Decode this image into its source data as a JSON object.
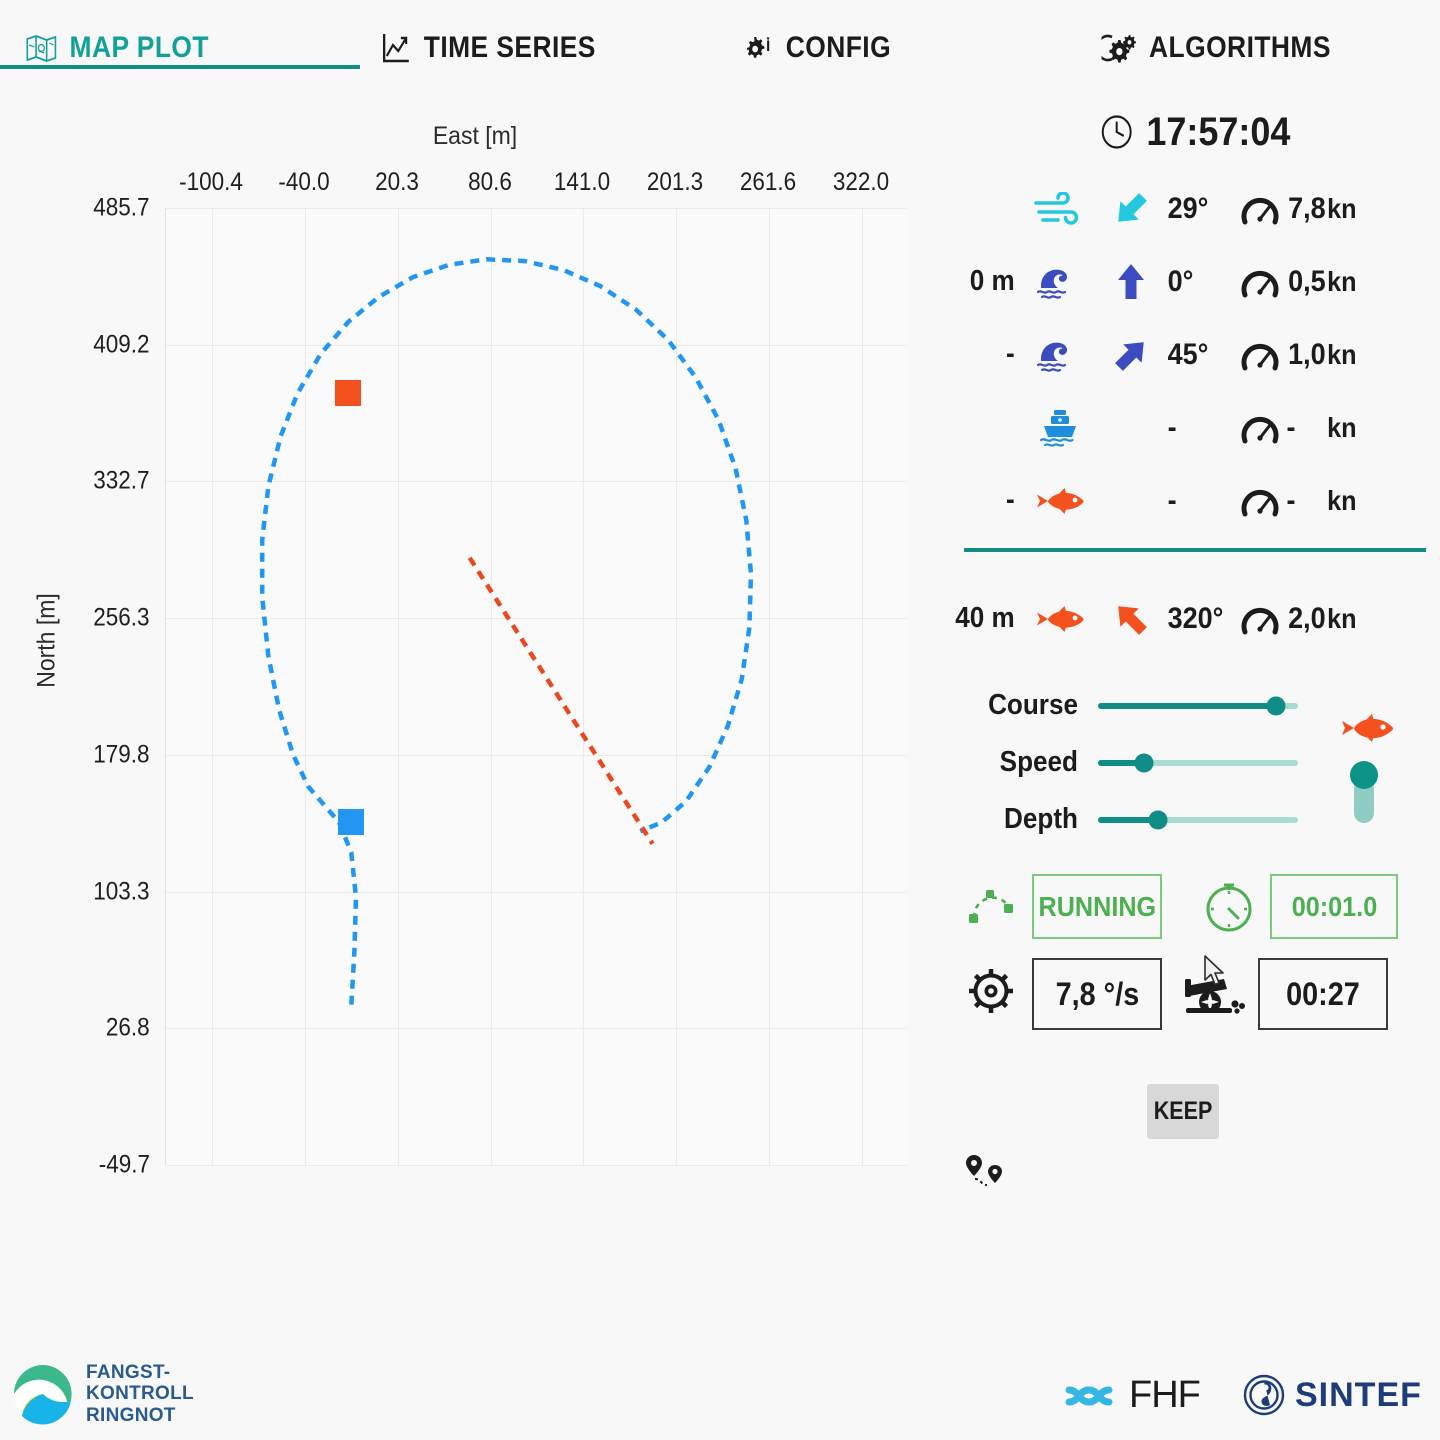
{
  "tabs": [
    {
      "label": "MAP PLOT",
      "icon": "map-icon",
      "active": true
    },
    {
      "label": "TIME SERIES",
      "icon": "line-chart-icon",
      "active": false
    },
    {
      "label": "CONFIG",
      "icon": "gear-wrench-icon",
      "active": false
    },
    {
      "label": "ALGORITHMS",
      "icon": "gears-icon",
      "active": false
    }
  ],
  "chart_data": {
    "type": "line",
    "title": "",
    "xlabel": "East [m]",
    "ylabel": "North [m]",
    "xlim": [
      -130.6,
      352.2
    ],
    "ylim": [
      -49.7,
      485.7
    ],
    "xticks": [
      "-100.4",
      "-40.0",
      "20.3",
      "80.6",
      "141.0",
      "201.3",
      "261.6",
      "322.0"
    ],
    "xtick_values": [
      -100.4,
      -40.0,
      20.3,
      80.6,
      141.0,
      201.3,
      261.6,
      322.0
    ],
    "yticks": [
      "485.7",
      "409.2",
      "332.7",
      "256.3",
      "179.8",
      "103.3",
      "26.8",
      "-49.7"
    ],
    "ytick_values": [
      485.7,
      409.2,
      332.7,
      256.3,
      179.8,
      103.3,
      26.8,
      -49.7
    ],
    "grid": true,
    "legend": "none",
    "series": [
      {
        "name": "vessel-track",
        "color": "#2196f3",
        "style": "dashed",
        "points": [
          [
            -10,
            40
          ],
          [
            -8,
            70
          ],
          [
            -7,
            100
          ],
          [
            -10,
            125
          ],
          [
            -18,
            142
          ],
          [
            -28,
            152
          ],
          [
            -38,
            162
          ],
          [
            -48,
            180
          ],
          [
            -57,
            205
          ],
          [
            -64,
            235
          ],
          [
            -68,
            268
          ],
          [
            -68,
            300
          ],
          [
            -64,
            330
          ],
          [
            -56,
            358
          ],
          [
            -45,
            382
          ],
          [
            -30,
            404
          ],
          [
            -12,
            422
          ],
          [
            8,
            436
          ],
          [
            30,
            447
          ],
          [
            54,
            454
          ],
          [
            78,
            457
          ],
          [
            103,
            456
          ],
          [
            128,
            451
          ],
          [
            152,
            442
          ],
          [
            175,
            429
          ],
          [
            196,
            412
          ],
          [
            214,
            391
          ],
          [
            229,
            367
          ],
          [
            240,
            340
          ],
          [
            247,
            311
          ],
          [
            250,
            281
          ],
          [
            249,
            251
          ],
          [
            244,
            222
          ],
          [
            235,
            196
          ],
          [
            223,
            173
          ],
          [
            208,
            154
          ],
          [
            192,
            142
          ],
          [
            178,
            137
          ]
        ]
      },
      {
        "name": "target-track",
        "color": "#e8491e",
        "style": "dashed",
        "points": [
          [
            67,
            290
          ],
          [
            186,
            130
          ]
        ]
      }
    ],
    "markers": [
      {
        "name": "target-marker",
        "color": "#f4511e",
        "x": -12,
        "y": 382,
        "shape": "square"
      },
      {
        "name": "vessel-marker",
        "color": "#2196f3",
        "x": -10,
        "y": 142,
        "shape": "square"
      }
    ]
  },
  "panel": {
    "clock": {
      "icon": "clock-icon",
      "time": "17:57:04"
    },
    "telemetry_rows": [
      {
        "name": "wind",
        "depth": "",
        "source_icon": "wind-icon",
        "source_color": "#22c8e0",
        "arrow_icon": "arrow-down-left-icon",
        "arrow_color": "#22c8e0",
        "direction": "29°",
        "gauge_icon": "gauge-icon",
        "speed": "7,8",
        "unit": "kn"
      },
      {
        "name": "surface-current",
        "depth": "0 m",
        "source_icon": "wave-icon",
        "source_color": "#3b4bc0",
        "arrow_icon": "arrow-up-icon",
        "arrow_color": "#3b4bc0",
        "direction": "0°",
        "gauge_icon": "gauge-icon",
        "speed": "0,5",
        "unit": "kn"
      },
      {
        "name": "deep-current",
        "depth": "-",
        "source_icon": "wave-icon",
        "source_color": "#3b4bc0",
        "arrow_icon": "arrow-up-right-icon",
        "arrow_color": "#3b4bc0",
        "direction": "45°",
        "gauge_icon": "gauge-icon",
        "speed": "1,0",
        "unit": "kn"
      },
      {
        "name": "vessel",
        "depth": "",
        "source_icon": "ship-icon",
        "source_color": "#1f8fdd",
        "arrow_icon": "",
        "arrow_color": "",
        "direction": "-",
        "gauge_icon": "gauge-icon",
        "speed": "-",
        "unit": "kn"
      },
      {
        "name": "school-measured",
        "depth": "-",
        "source_icon": "fish-icon",
        "source_color": "#f4511e",
        "arrow_icon": "",
        "arrow_color": "",
        "direction": "-",
        "gauge_icon": "gauge-icon",
        "speed": "-",
        "unit": "kn"
      }
    ],
    "target_row": {
      "name": "school-target",
      "depth": "40 m",
      "source_icon": "fish-icon",
      "source_color": "#f4511e",
      "arrow_icon": "arrow-up-left-icon",
      "arrow_color": "#f4511e",
      "direction": "320°",
      "gauge_icon": "gauge-icon",
      "speed": "2,0",
      "unit": "kn"
    },
    "sliders": [
      {
        "name": "course",
        "label": "Course",
        "value_pct": 89
      },
      {
        "name": "speed",
        "label": "Speed",
        "value_pct": 23
      },
      {
        "name": "depth",
        "label": "Depth",
        "value_pct": 30
      }
    ],
    "vertical_slider": {
      "name": "depth-vertical-slider",
      "value_pct": 100
    },
    "slider_fish_icon": "fish-icon",
    "status": {
      "path_icon": "path-curve-icon",
      "state": "RUNNING",
      "timer_icon": "stopwatch-icon",
      "timer": "00:01.0",
      "helm_icon": "ships-wheel-icon",
      "turn_rate": "7,8 °/s",
      "cannon_icon": "cannon-icon",
      "countdown": "00:27"
    },
    "keep_button": "KEEP",
    "route_icon": "route-pins-icon"
  },
  "footer": {
    "left_logo": {
      "name": "fangstkontroll-ringnot-logo",
      "lines": [
        "FANGST-",
        "KONTROLL",
        "RINGNOT"
      ]
    },
    "fhf_logo": {
      "name": "fhf-logo",
      "text": "FHF"
    },
    "sintef_logo": {
      "name": "sintef-logo",
      "text": "SINTEF"
    }
  },
  "colors": {
    "accent_teal": "#0f8d86",
    "orange": "#f4511e",
    "blue": "#2196f3",
    "green": "#4caf50",
    "cyan": "#22c8e0",
    "navy": "#3b4bc0",
    "background": "#f8f8f8"
  }
}
